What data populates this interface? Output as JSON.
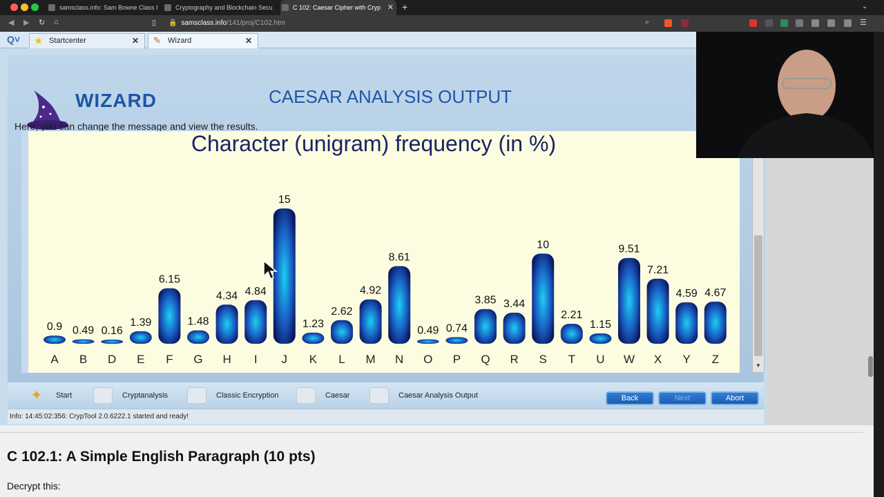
{
  "browser": {
    "tabs": [
      {
        "label": "samsclass.info: Sam Bowne Class In"
      },
      {
        "label": "Cryptography and Blockchain Secu"
      },
      {
        "label": "C 102: Caesar Cipher with Cryp"
      }
    ],
    "url_host": "samsclass.info",
    "url_path": "/141/proj/C102.htm"
  },
  "app": {
    "tabs": [
      {
        "label": "Startcenter"
      },
      {
        "label": "Wizard"
      }
    ],
    "wizard_label": "WIZARD",
    "page_title": "CAESAR ANALYSIS OUTPUT",
    "subtitle": "Here, you can change the message and view the results.",
    "breadcrumbs": [
      {
        "label": "Start"
      },
      {
        "label": "Cryptanalysis"
      },
      {
        "label": "Classic Encryption"
      },
      {
        "label": "Caesar"
      },
      {
        "label": "Caesar Analysis Output"
      }
    ],
    "buttons": {
      "back": "Back",
      "next": "Next",
      "abort": "Abort"
    },
    "info": "Info: 14:45:02:356: CrypTool 2.0.6222.1 started and ready!"
  },
  "webpage": {
    "heading": "C 102.1: A Simple English Paragraph (10 pts)",
    "text": "Decrypt this:"
  },
  "colors": {
    "bar_top": "#0a1d7a",
    "bar_mid": "#1bb5e8",
    "chart_bg": "#fcfde0",
    "accent": "#1e55a8"
  },
  "chart_data": {
    "type": "bar",
    "title": "Character (unigram) frequency (in %)",
    "categories": [
      "A",
      "B",
      "D",
      "E",
      "F",
      "G",
      "H",
      "I",
      "J",
      "K",
      "L",
      "M",
      "N",
      "O",
      "P",
      "Q",
      "R",
      "S",
      "T",
      "U",
      "W",
      "X",
      "Y",
      "Z"
    ],
    "values": [
      0.9,
      0.49,
      0.16,
      1.39,
      6.15,
      1.48,
      4.34,
      4.84,
      15,
      1.23,
      2.62,
      4.92,
      8.61,
      0.49,
      0.74,
      3.85,
      3.44,
      10,
      2.21,
      1.15,
      9.51,
      7.21,
      4.59,
      4.67
    ],
    "labels": [
      "0.9",
      "0.49",
      "0.16",
      "1.39",
      "6.15",
      "1.48",
      "4.34",
      "4.84",
      "15",
      "1.23",
      "2.62",
      "4.92",
      "8.61",
      "0.49",
      "0.74",
      "3.85",
      "3.44",
      "10",
      "2.21",
      "1.15",
      "9.51",
      "7.21",
      "4.59",
      "4.67"
    ],
    "ylim": [
      0,
      15
    ],
    "grid": false
  }
}
